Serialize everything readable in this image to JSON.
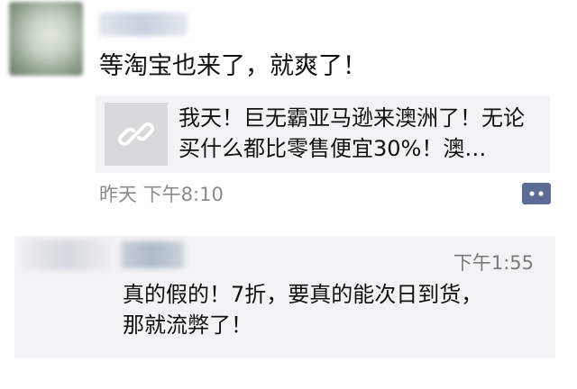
{
  "post": {
    "text": "等淘宝也来了，就爽了！",
    "link": {
      "title": "我天！巨无霸亚马逊来澳洲了！无论买什么都比零售便宜30%！澳…",
      "thumbnail_icon": "link-icon"
    },
    "time": "昨天  下午8:10",
    "comment_icon": "comment-bubble-icon"
  },
  "comment": {
    "time": "下午1:55",
    "lines": [
      "真的假的！7折，要真的能次日到货，",
      "那就流弊了！"
    ]
  },
  "colors": {
    "link_blue": "#5b6b95",
    "card_bg": "#f3f3f5",
    "muted_text": "#8a8a8a"
  }
}
